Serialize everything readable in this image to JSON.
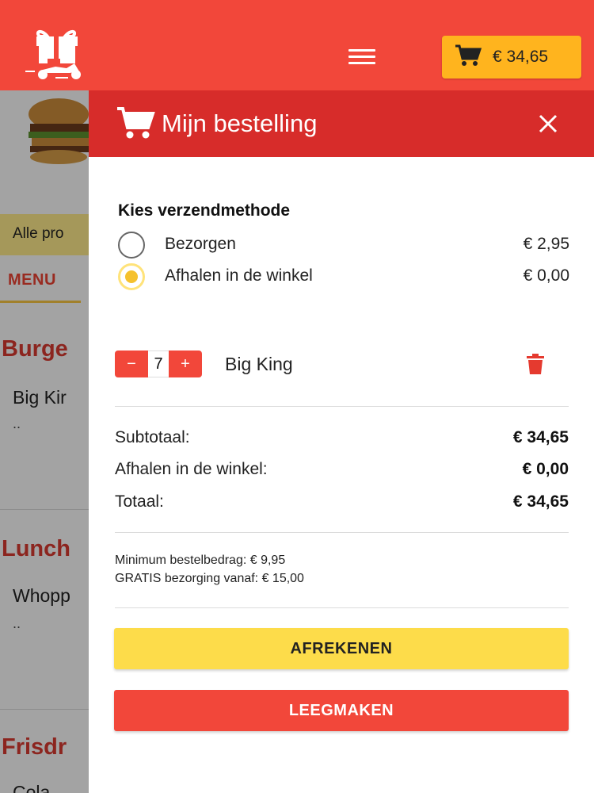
{
  "header": {
    "cart_total": "€ 34,65",
    "accent_color": "#f2473a",
    "cart_button_color": "#ffb41e"
  },
  "background_page": {
    "filter_label": "Alle pro",
    "menu_tab": "MENU",
    "categories": [
      {
        "title": "Burge",
        "item": "Big Kir",
        "dots": ".."
      },
      {
        "title": "Lunch",
        "item": "Whopp",
        "dots": ".."
      },
      {
        "title": "Frisdr",
        "item": "Cola"
      }
    ]
  },
  "drawer": {
    "title": "Mijn bestelling",
    "shipping_label": "Kies verzendmethode",
    "shipping_options": [
      {
        "label": "Bezorgen",
        "price": "€ 2,95",
        "selected": false
      },
      {
        "label": "Afhalen in de winkel",
        "price": "€ 0,00",
        "selected": true
      }
    ],
    "item": {
      "quantity": "7",
      "name": "Big King",
      "minus": "−",
      "plus": "+"
    },
    "summary": [
      {
        "label": "Subtotaal:",
        "value": "€ 34,65"
      },
      {
        "label": "Afhalen in de winkel:",
        "value": "€ 0,00"
      },
      {
        "label": "Totaal:",
        "value": "€ 34,65"
      }
    ],
    "notes": [
      "Minimum bestelbedrag: € 9,95",
      "GRATIS bezorging vanaf: € 15,00"
    ],
    "checkout_label": "AFREKENEN",
    "empty_label": "LEEGMAKEN",
    "header_color": "#d72c2a",
    "checkout_color": "#fddc4a"
  }
}
